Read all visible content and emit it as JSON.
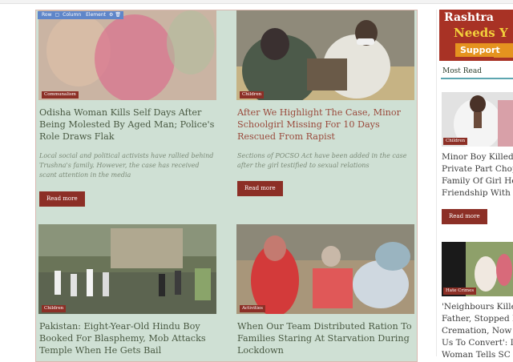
{
  "editor_toolbar": {
    "row": "Row",
    "column": "Column",
    "element": "Element"
  },
  "cards": [
    {
      "category": "Communalism",
      "title": "Odisha Woman Kills Self Days After Being Molested By Aged Man; Police's Role Draws Flak",
      "excerpt": "Local social and political activists have rallied behind Trushna's family. However, the case has received scant attention in the media",
      "read_more": "Read more"
    },
    {
      "category": "Children",
      "title": "After We Highlight The Case, Minor Schoolgirl Missing For 10 Days Rescued From Rapist",
      "excerpt": "Sections of POCSO Act have been added in the case after the girl testified to sexual relations",
      "read_more": "Read more"
    },
    {
      "category": "Children",
      "title": "Pakistan: Eight-Year-Old Hindu Boy Booked For Blasphemy, Mob Attacks Temple When He Gets Bail"
    },
    {
      "category": "Activities",
      "title": "When Our Team Distributed Ration To Families Staring At Starvation During Lockdown"
    }
  ],
  "sidebar": {
    "banner_line1": "Rashtra",
    "banner_line2": "Needs Y",
    "banner_button": "Support",
    "most_read_label": "Most Read",
    "items": [
      {
        "category": "Children",
        "title_lines": [
          "Minor Boy Killed,",
          "Private Part Chop",
          "Family Of Girl He",
          "Friendship With"
        ],
        "read_more": "Read more"
      },
      {
        "category": "Hate Crimes",
        "title_lines": [
          "'Neighbours Kille",
          "Father, Stopped H",
          "Cremation, Now",
          "Us To Convert': D",
          "Woman Tells SC"
        ]
      }
    ]
  }
}
